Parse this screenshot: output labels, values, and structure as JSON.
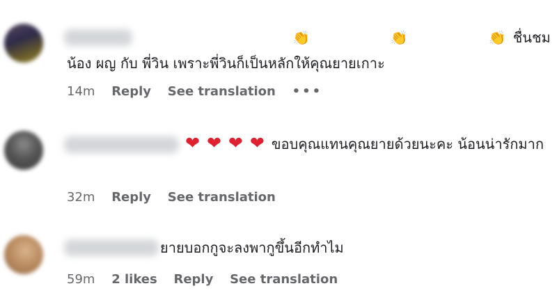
{
  "comments": [
    {
      "emojis": [
        "👏",
        "👏",
        "👏"
      ],
      "text": "ชื่นชมน้อง ผญ กับ พี่วิน เพราะพี่วินก็เป็นหลักให้คุณยายเกาะ",
      "time": "14m",
      "reply": "Reply",
      "translate": "See translation",
      "more": "•••"
    },
    {
      "emojis": [
        "❤",
        "❤",
        "❤",
        "❤"
      ],
      "text": "ขอบคุณแทนคุณยายด้วยนะคะ น้อนน่ารักมาก",
      "time": "32m",
      "reply": "Reply",
      "translate": "See translation"
    },
    {
      "text": "ยายบอกกูจะลงพากูขึ้นอีกทำไม",
      "time": "59m",
      "likes": "2 likes",
      "reply": "Reply",
      "translate": "See translation"
    }
  ],
  "colors": {
    "meta": "#65676b",
    "heart": "#e02030",
    "text": "#1c1e21"
  }
}
